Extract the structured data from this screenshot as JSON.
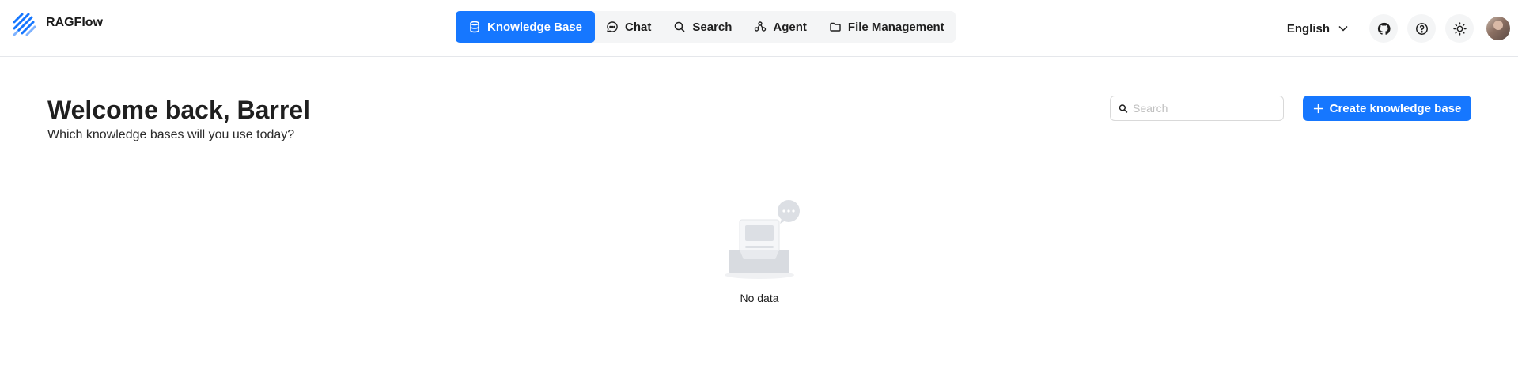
{
  "app": {
    "name": "RAGFlow",
    "accent_color": "#1677ff"
  },
  "nav": {
    "items": [
      {
        "label": "Knowledge Base",
        "icon": "database-icon",
        "active": true
      },
      {
        "label": "Chat",
        "icon": "chat-bubble-icon",
        "active": false
      },
      {
        "label": "Search",
        "icon": "search-icon",
        "active": false
      },
      {
        "label": "Agent",
        "icon": "agent-nodes-icon",
        "active": false
      },
      {
        "label": "File Management",
        "icon": "folder-icon",
        "active": false
      }
    ]
  },
  "header": {
    "language": "English",
    "icons": [
      "github-icon",
      "help-icon",
      "theme-sun-icon"
    ]
  },
  "main": {
    "welcome": "Welcome back, Barrel",
    "subtitle": "Which knowledge bases will you use today?",
    "search_placeholder": "Search",
    "create_button": "Create knowledge base",
    "empty_text": "No data"
  }
}
